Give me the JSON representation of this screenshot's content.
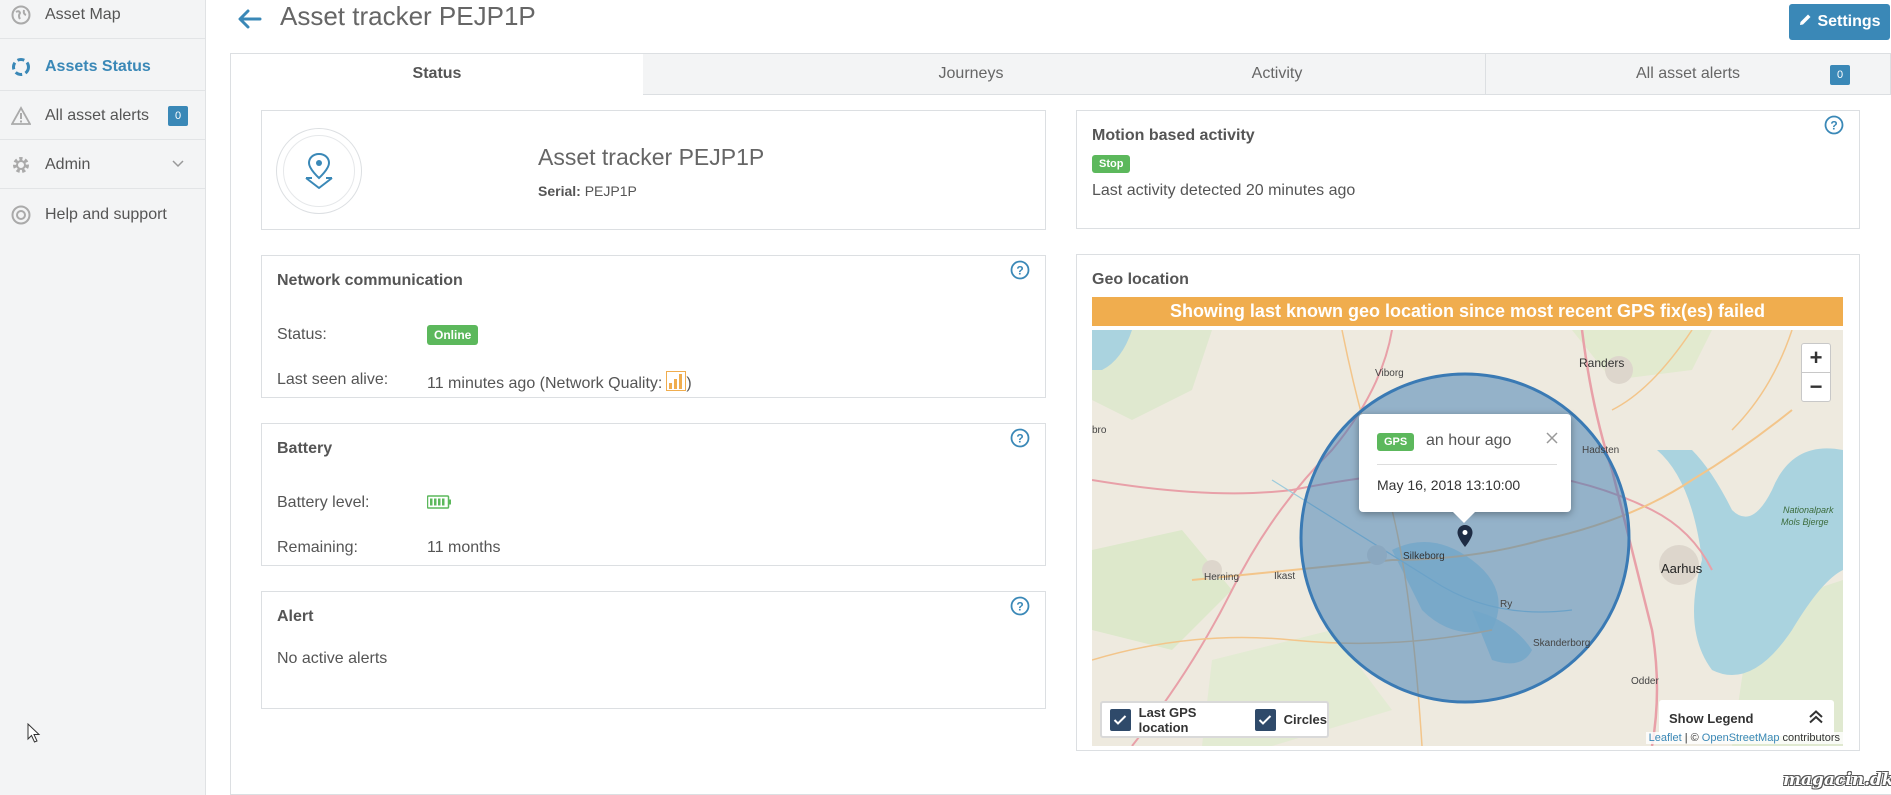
{
  "sidebar": {
    "items": [
      {
        "label": "Asset Map",
        "icon": "globe-icon"
      },
      {
        "label": "Assets Status",
        "icon": "circle-dots-icon",
        "active": true
      },
      {
        "label": "All asset alerts",
        "icon": "warning-icon",
        "badge": "0"
      },
      {
        "label": "Admin",
        "icon": "gear-icon"
      },
      {
        "label": "Help and support",
        "icon": "lifebuoy-icon"
      }
    ]
  },
  "header": {
    "title": "Asset tracker PEJP1P",
    "settings_label": "Settings"
  },
  "tabs": [
    {
      "label": "Status",
      "active": true
    },
    {
      "label": "Journeys"
    },
    {
      "label": "Activity"
    },
    {
      "label": "All asset alerts",
      "badge": "0"
    }
  ],
  "device": {
    "name": "Asset tracker PEJP1P",
    "serial_label": "Serial:",
    "serial": "PEJP1P"
  },
  "network": {
    "title": "Network communication",
    "status_label": "Status:",
    "status_value": "Online",
    "last_seen_label": "Last seen alive:",
    "last_seen_value": "11 minutes ago (Network Quality:",
    "last_seen_suffix": ")"
  },
  "battery": {
    "title": "Battery",
    "level_label": "Battery level:",
    "remaining_label": "Remaining:",
    "remaining_value": "11 months"
  },
  "alert": {
    "title": "Alert",
    "message": "No active alerts"
  },
  "motion": {
    "title": "Motion based activity",
    "badge": "Stop",
    "text": "Last activity detected 20 minutes ago"
  },
  "geo": {
    "title": "Geo location",
    "banner": "Showing last known geo location since most recent GPS fix(es) failed",
    "popup_badge": "GPS",
    "popup_time": "an hour ago",
    "popup_date": "May 16, 2018 13:10:00",
    "toggle_gps": "Last GPS location",
    "toggle_circles": "Circles",
    "legend": "Show Legend",
    "zoom_in": "+",
    "zoom_out": "−",
    "attrib_leaflet": "Leaflet",
    "attrib_sep": "| ©",
    "attrib_osm": "OpenStreetMap",
    "attrib_contrib": "contributors",
    "places": [
      "Randers",
      "Viborg",
      "Hadsten",
      "Silkeborg",
      "Herning",
      "Ikast",
      "Aarhus",
      "Ry",
      "Skanderborg",
      "Odder",
      "Nationalpark",
      "Mols Bjerge",
      "bro"
    ]
  },
  "colors": {
    "accent": "#3a88b7",
    "success": "#5cb85c",
    "warning": "#f0ad4e"
  },
  "watermark": "magacin.dk"
}
